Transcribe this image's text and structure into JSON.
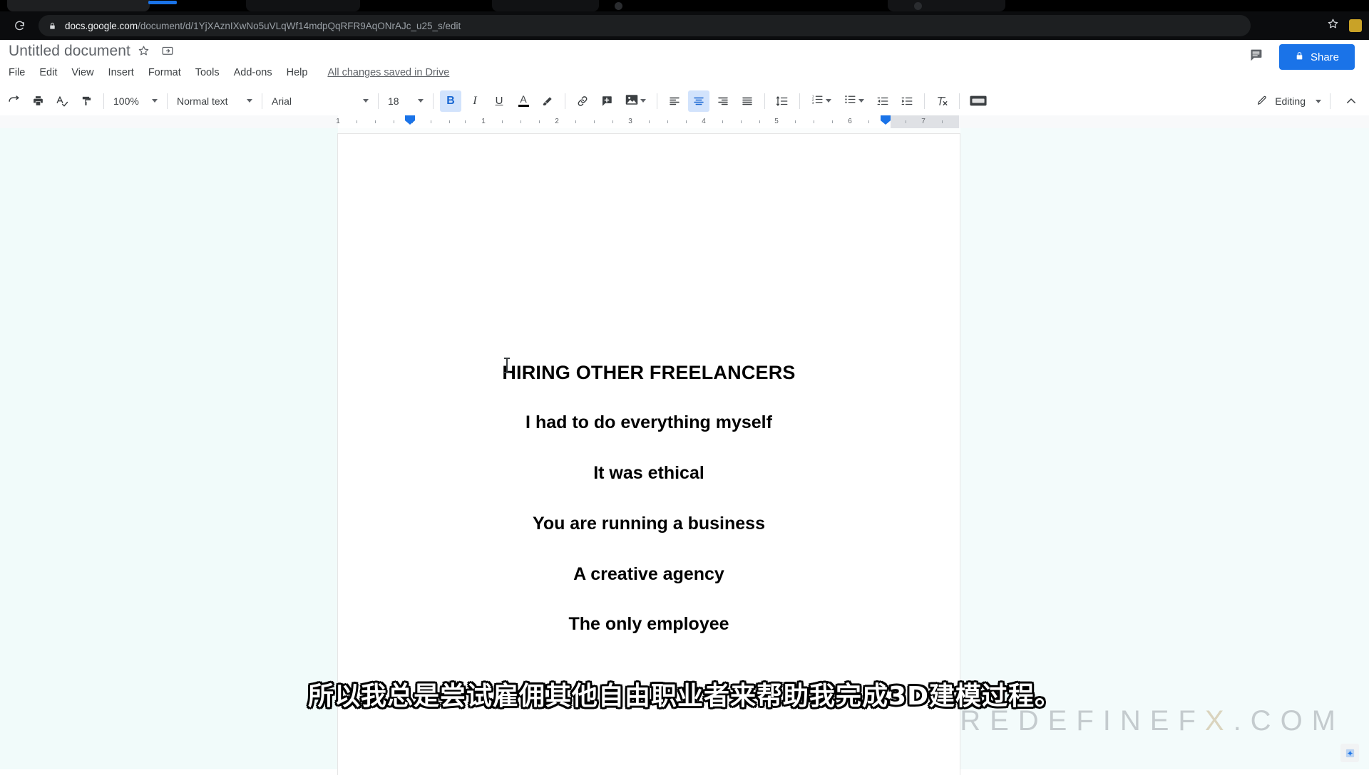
{
  "browser": {
    "url": {
      "host": "docs.google.com",
      "path": "/document/d/1YjXAznIXwNo5uVLqWf14mdpQqRFR9AqONrAJc_u25_s/edit"
    },
    "reload_icon": "reload-icon",
    "lock_icon": "lock-icon",
    "bookmark_icon": "star-icon",
    "extension_icon": "extension-icon"
  },
  "docs": {
    "title": "Untitled document",
    "star_icon": "star-icon",
    "move_icon": "move-to-folder-icon",
    "menus": [
      "File",
      "Edit",
      "View",
      "Insert",
      "Format",
      "Tools",
      "Add-ons",
      "Help"
    ],
    "save_status": "All changes saved in Drive",
    "comment_icon": "comment-icon",
    "share_label": "Share",
    "share_lock_icon": "lock-icon",
    "share_color": "#1a73e8"
  },
  "toolbar": {
    "redo_icon": "redo-icon",
    "print_icon": "print-icon",
    "spellcheck_icon": "spellcheck-icon",
    "paint_format_icon": "paint-format-icon",
    "zoom": "100%",
    "paragraph_style": "Normal text",
    "font": "Arial",
    "font_size": "18",
    "bold_label": "B",
    "italic_label": "I",
    "underline_label": "U",
    "text_color_label": "A",
    "highlight_icon": "highlighter-icon",
    "link_icon": "link-icon",
    "comment_add_icon": "add-comment-icon",
    "image_icon": "insert-image-icon",
    "align_left_icon": "align-left-icon",
    "align_center_icon": "align-center-icon",
    "align_right_icon": "align-right-icon",
    "align_justify_icon": "align-justify-icon",
    "line_spacing_icon": "line-spacing-icon",
    "numbered_list_icon": "numbered-list-icon",
    "bulleted_list_icon": "bulleted-list-icon",
    "decrease_indent_icon": "decrease-indent-icon",
    "increase_indent_icon": "increase-indent-icon",
    "clear_formatting_icon": "clear-formatting-icon",
    "input_tools_icon": "input-tools-icon",
    "active_buttons": [
      "bold",
      "align-center"
    ],
    "mode_label": "Editing",
    "mode_pencil_icon": "pencil-icon",
    "mode_caret_icon": "chevron-down-icon",
    "collapse_icon": "chevron-up-icon",
    "accent_color": "#1a73e8",
    "active_bg": "#d2e3fc"
  },
  "ruler": {
    "numbers": [
      "1",
      "2",
      "3",
      "4",
      "5",
      "6",
      "7"
    ],
    "left_indent_marker": "indent-marker",
    "right_indent_marker": "indent-marker"
  },
  "document": {
    "heading": "HIRING OTHER FREELANCERS",
    "lines": [
      "I had to do everything myself",
      "It was ethical",
      "You are running a business",
      "A creative agency",
      "The only employee"
    ]
  },
  "overlay": {
    "subtitle": "所以我总是尝试雇佣其他自由职业者来帮助我完成3D建模过程。",
    "watermark_main": "REDEFINEF",
    "watermark_accent": "X",
    "watermark_tail": ".COM"
  },
  "explore": {
    "icon": "explore-icon"
  }
}
